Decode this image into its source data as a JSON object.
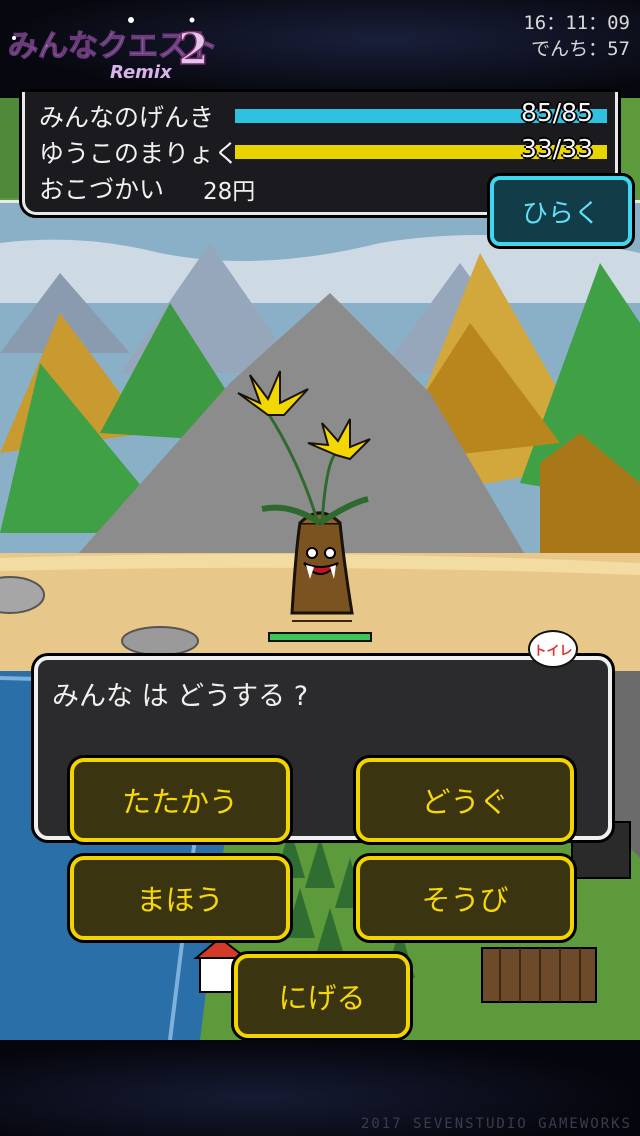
{
  "header": {
    "logo_text": "みんなクエスト",
    "logo_number": "2",
    "logo_sub": "Remix",
    "clock_time": "16：11：09",
    "battery_label": "でんち：57"
  },
  "status": {
    "hp_label": "みんなのげんき",
    "hp_value": "85/85",
    "hp_fraction": 1.0,
    "mp_label": "ゆうこのまりょく",
    "mp_value": "33/33",
    "mp_fraction": 1.0,
    "money_label": "おこづかい",
    "money_value": "28円",
    "open_button": "ひらく"
  },
  "battle": {
    "enemy_hp_fraction": 1.0,
    "message": "みんな は どうする ?",
    "toilet_label": "トイレ"
  },
  "commands": {
    "fight": "たたかう",
    "item": "どうぐ",
    "magic": "まほう",
    "equip": "そうび",
    "run": "にげる"
  },
  "footer": {
    "copyright": "2017 SEVENSTUDIO GAMEWORKS"
  },
  "colors": {
    "hp_bar": "#2fc1e0",
    "mp_bar": "#e8d400",
    "command_border": "#f2d400",
    "open_border": "#3fd6f0"
  }
}
